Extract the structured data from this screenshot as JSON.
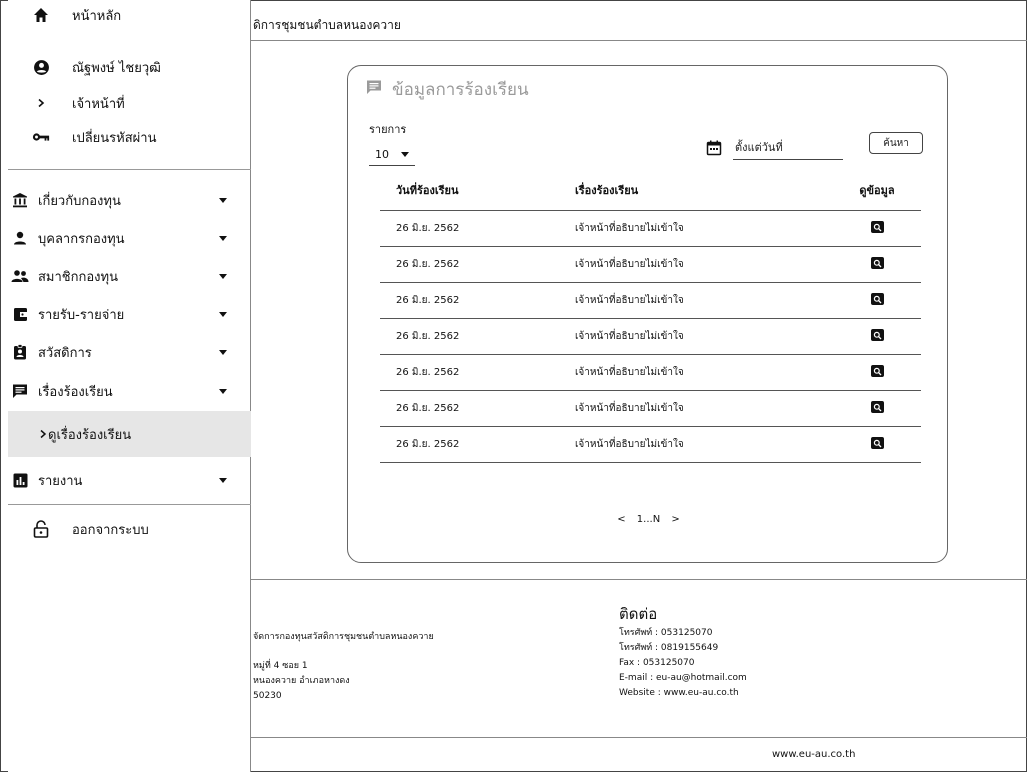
{
  "header": {
    "title": "ดิการชุมชนตำบลหนองควาย"
  },
  "sidebar": {
    "top_items": [
      {
        "label": "หน้าหลัก",
        "icon": "home-icon"
      },
      {
        "label": "ณัฐพงษ์ ไชยวุฒิ",
        "icon": "account-circle-icon"
      },
      {
        "label": "เจ้าหน้าที่",
        "icon": "chevron-right-icon"
      },
      {
        "label": "เปลี่ยนรหัสผ่าน",
        "icon": "key-icon"
      }
    ],
    "menu_items": [
      {
        "label": "เกี่ยวกับกองทุน",
        "icon": "bank-icon"
      },
      {
        "label": "บุคลากรกองทุน",
        "icon": "person-icon"
      },
      {
        "label": "สมาชิกกองทุน",
        "icon": "group-icon"
      },
      {
        "label": "รายรับ-รายจ่าย",
        "icon": "wallet-icon"
      },
      {
        "label": "สวัสดิการ",
        "icon": "badge-icon"
      },
      {
        "label": "เรื่องร้องเรียน",
        "icon": "comment-icon"
      }
    ],
    "submenu_item": {
      "label": "ดูเรื่องร้องเรียน",
      "icon": "chevron-right-icon"
    },
    "report_item": {
      "label": "รายงาน",
      "icon": "bar-chart-icon"
    },
    "logout": {
      "label": "ออกจากระบบ",
      "icon": "lock-open-icon"
    }
  },
  "card": {
    "title": "ข้อมูลการร้องเรียน",
    "title_icon": "comment-icon",
    "show_label": "รายการ",
    "show_value": "10",
    "date_placeholder": "ตั้งแต่วันที่",
    "search_label": "ค้นหา",
    "columns": [
      "วันที่ร้องเรียน",
      "เรื่องร้องเรียน",
      "ดูข้อมูล"
    ],
    "rows": [
      {
        "date": "26 มิ.ย. 2562",
        "subject": "เจ้าหน้าที่อธิบายไม่เข้าใจ"
      },
      {
        "date": "26 มิ.ย. 2562",
        "subject": "เจ้าหน้าที่อธิบายไม่เข้าใจ"
      },
      {
        "date": "26 มิ.ย. 2562",
        "subject": "เจ้าหน้าที่อธิบายไม่เข้าใจ"
      },
      {
        "date": "26 มิ.ย. 2562",
        "subject": "เจ้าหน้าที่อธิบายไม่เข้าใจ"
      },
      {
        "date": "26 มิ.ย. 2562",
        "subject": "เจ้าหน้าที่อธิบายไม่เข้าใจ"
      },
      {
        "date": "26 มิ.ย. 2562",
        "subject": "เจ้าหน้าที่อธิบายไม่เข้าใจ"
      },
      {
        "date": "26 มิ.ย. 2562",
        "subject": "เจ้าหน้าที่อธิบายไม่เข้าใจ"
      }
    ],
    "pager": {
      "prev": "<",
      "range": "1...N",
      "next": ">"
    }
  },
  "footer": {
    "left_lines": [
      "จัดการกองทุนสวัสดิการชุมชนตำบลหนองควาย",
      "",
      "หมู่ที่ 4 ซอย 1",
      "หนองควาย อำเภอหางดง",
      "50230"
    ],
    "contact_title": "ติดต่อ",
    "contact_lines": [
      "โทรศัพท์ : 053125070",
      "โทรศัพท์ : 0819155649",
      "Fax : 053125070",
      "E-mail : eu-au@hotmail.com",
      "Website : www.eu-au.co.th"
    ],
    "bottom_url": "www.eu-au.co.th"
  }
}
